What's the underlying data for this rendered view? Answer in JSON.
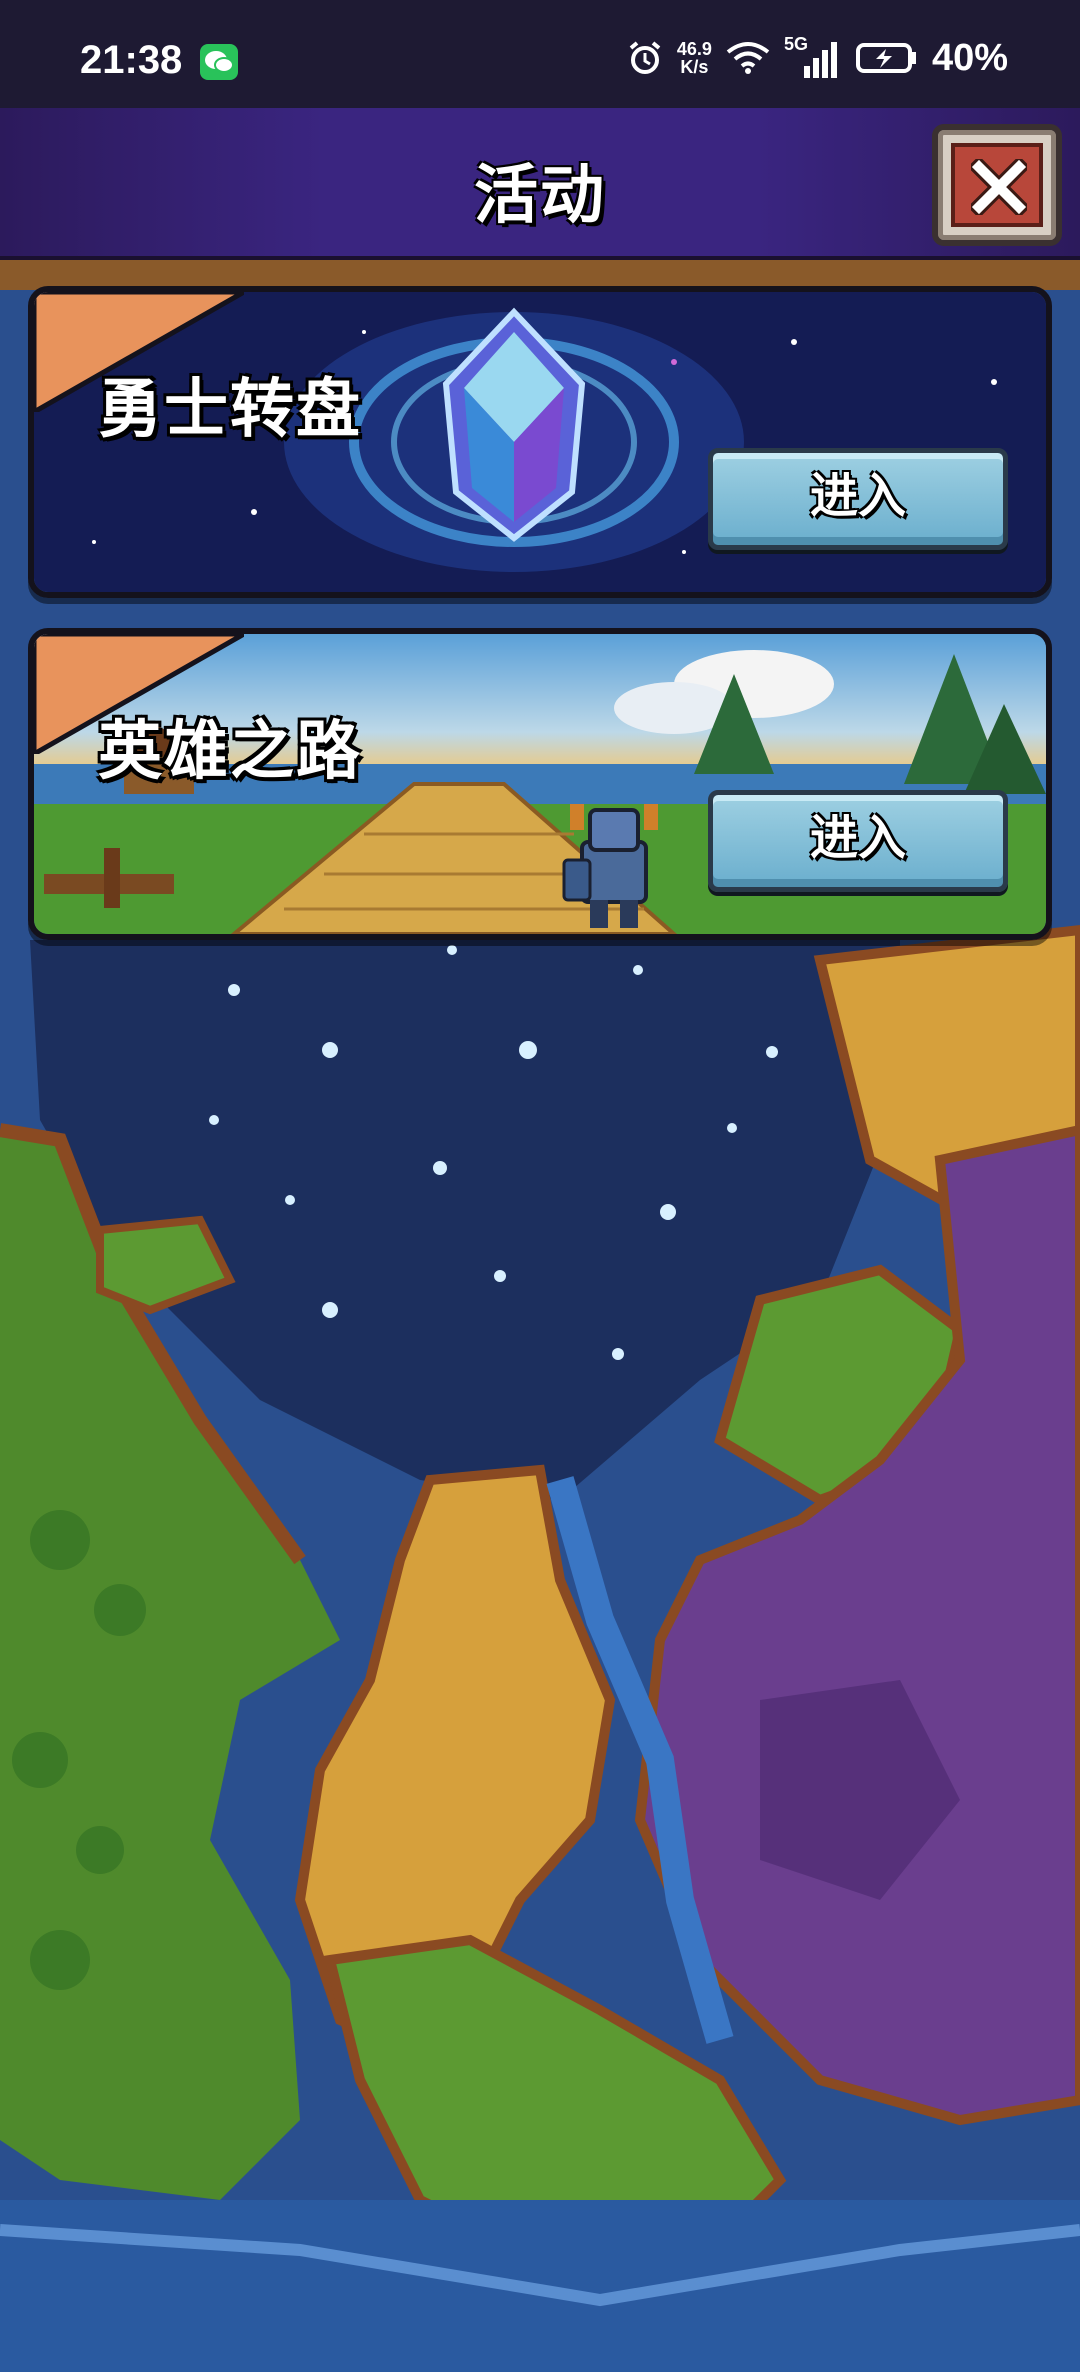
{
  "status_bar": {
    "time": "21:38",
    "net_speed_value": "46.9",
    "net_speed_unit": "K/s",
    "signal_label": "5G",
    "battery": "40%",
    "icons": [
      "wechat-icon",
      "alarm-icon",
      "wifi-icon",
      "signal-icon",
      "battery-charging-icon"
    ]
  },
  "header": {
    "title": "活动",
    "close_icon": "close-icon"
  },
  "activities": [
    {
      "title": "勇士转盘",
      "button_label": "进入",
      "art": "crystal-in-starry-space"
    },
    {
      "title": "英雄之路",
      "button_label": "进入",
      "art": "knight-on-path-landscape"
    }
  ],
  "colors": {
    "header_bg": "#3a2580",
    "corner_tag": "#e8935c",
    "button": "#8cc4dc",
    "close_button": "#b8473a"
  }
}
